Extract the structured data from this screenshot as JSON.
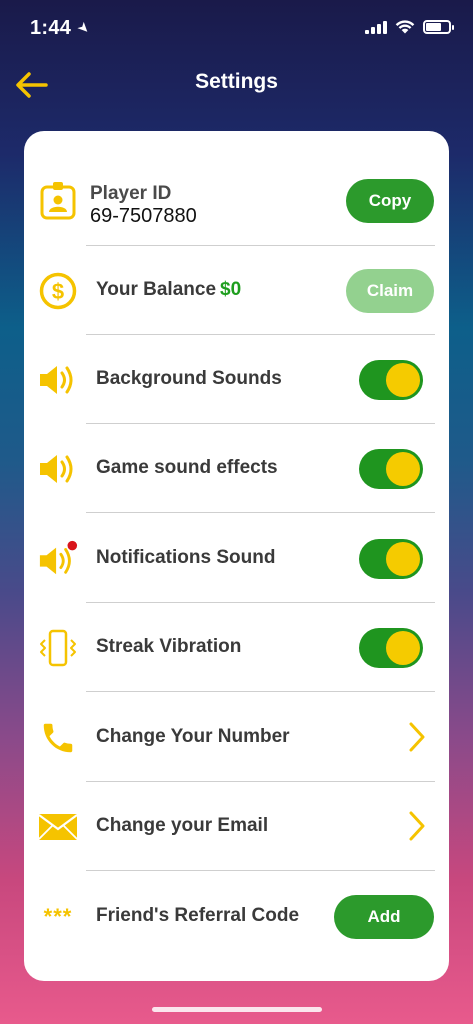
{
  "status_bar": {
    "time": "1:44"
  },
  "nav": {
    "title": "Settings"
  },
  "player": {
    "title": "Player ID",
    "id": "69-7507880",
    "copy_label": "Copy"
  },
  "balance": {
    "label": "Your Balance",
    "value": "$0",
    "claim_label": "Claim"
  },
  "toggles": [
    {
      "label": "Background Sounds",
      "on": true
    },
    {
      "label": "Game sound effects",
      "on": true
    },
    {
      "label": "Notifications Sound",
      "on": true
    },
    {
      "label": "Streak Vibration",
      "on": true
    }
  ],
  "links": [
    {
      "label": "Change Your Number"
    },
    {
      "label": "Change your Email"
    }
  ],
  "referral": {
    "stars": "***",
    "label": "Friend's Referral Code",
    "add_label": "Add"
  },
  "colors": {
    "accent_yellow": "#f5c300",
    "toggle_green": "#1f951f",
    "button_green": "#2c9a2c",
    "claim_disabled": "#93d18f",
    "balance_green": "#1e9e1e"
  }
}
